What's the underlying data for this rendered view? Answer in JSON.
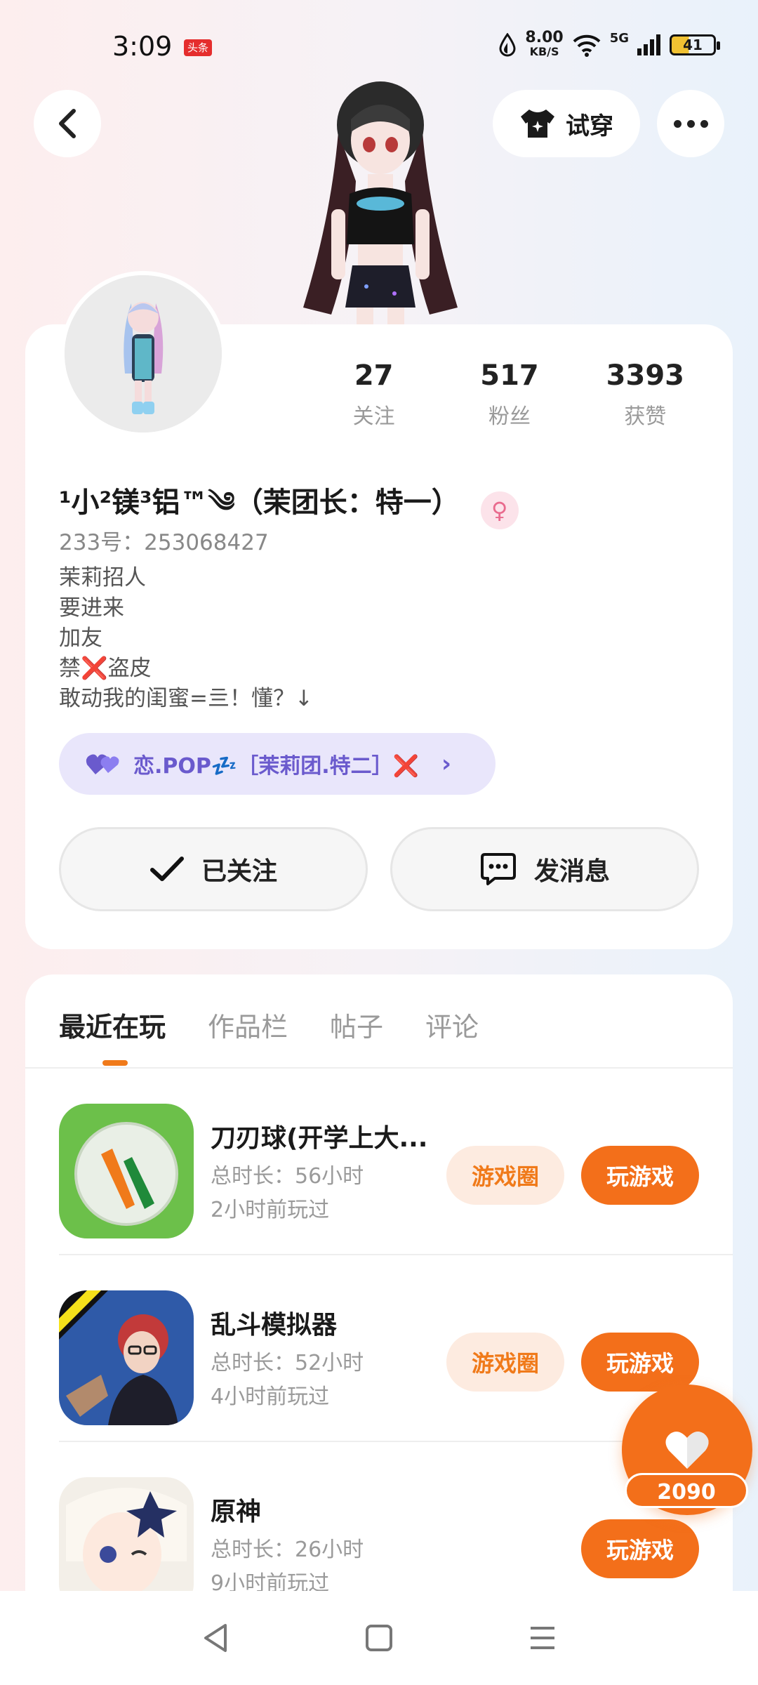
{
  "status": {
    "time": "3:09",
    "news_badge": "头条",
    "net_speed": "8.00",
    "net_unit": "KB/S",
    "signal": "5G",
    "battery": "41"
  },
  "header": {
    "try_on_label": "试穿"
  },
  "profile": {
    "stats": [
      {
        "value": "27",
        "label": "关注"
      },
      {
        "value": "517",
        "label": "粉丝"
      },
      {
        "value": "3393",
        "label": "获赞"
      }
    ],
    "name": "¹小²镁³铝™༄（茉团长：特一）",
    "uid": "233号：253068427",
    "bio": [
      "茉莉招人",
      "要进来",
      "加友",
      "禁❌盗皮",
      "敢动我的闺蜜=亖！懂？↓"
    ],
    "club": "恋.POP💤［茉莉团.特二］❌",
    "follow_label": "已关注",
    "message_label": "发消息"
  },
  "tabs": [
    {
      "label": "最近在玩",
      "active": true
    },
    {
      "label": "作品栏",
      "active": false
    },
    {
      "label": "帖子",
      "active": false
    },
    {
      "label": "评论",
      "active": false
    }
  ],
  "games": [
    {
      "title": "刀刃球(开学上大...",
      "duration": "总时长：56小时",
      "last_played": "2小时前玩过",
      "circle_label": "游戏圈",
      "play_label": "玩游戏"
    },
    {
      "title": "乱斗模拟器",
      "duration": "总时长：52小时",
      "last_played": "4小时前玩过",
      "circle_label": "游戏圈",
      "play_label": "玩游戏"
    },
    {
      "title": "原神",
      "duration": "总时长：26小时",
      "last_played": "9小时前玩过",
      "play_label": "玩游戏"
    }
  ],
  "like": {
    "count": "2090"
  },
  "colors": {
    "accent": "#f36f1a",
    "club_bg": "#e9e6fb",
    "club_text": "#6a5acd"
  }
}
